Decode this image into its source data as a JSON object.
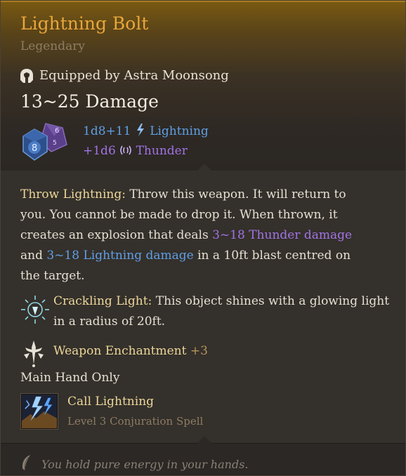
{
  "item": {
    "name": "Lightning Bolt",
    "rarity": "Legendary",
    "equipped_text": "Equipped by Astra Moonsong",
    "damage": "13~25 Damage",
    "damage_rolls": [
      {
        "dice": "1d8+11",
        "type": "Lightning",
        "icon": "lightning-icon",
        "color": "#5f9fe6"
      },
      {
        "dice": "+1d6",
        "type": "Thunder",
        "icon": "thunder-icon",
        "color": "#a273e6"
      }
    ],
    "dice_faces": [
      "8",
      "6",
      "5"
    ]
  },
  "ability": {
    "name": "Throw Lightning:",
    "line1": " Throw this weapon. It will return to",
    "line2": "you. You cannot be made to drop it. When thrown, it",
    "line3_pre": "creates an explosion that deals ",
    "thunder_damage": "3~18 Thunder damage",
    "line4_pre": "and ",
    "lightning_damage": "3~18 Lightning damage",
    "line4_post": " in a 10ft blast centred on",
    "line5": "the target."
  },
  "property": {
    "name": "Crackling Light:",
    "line1": " This object shines with a glowing light",
    "line2": "in a radius of 20ft.",
    "icon": "crackling-light-icon"
  },
  "enchantment": {
    "label": "Weapon Enchantment",
    "value": "+3",
    "icon": "enchantment-icon"
  },
  "slot": "Main Hand Only",
  "spell": {
    "name": "Call Lightning",
    "level": "Level 3 Conjuration Spell",
    "icon": "call-lightning-icon"
  },
  "flavor": "You hold pure energy in your hands.",
  "colors": {
    "title": "#e9a63a",
    "lightning": "#5f9fe6",
    "thunder": "#a273e6",
    "keyword": "#ecd79a"
  }
}
